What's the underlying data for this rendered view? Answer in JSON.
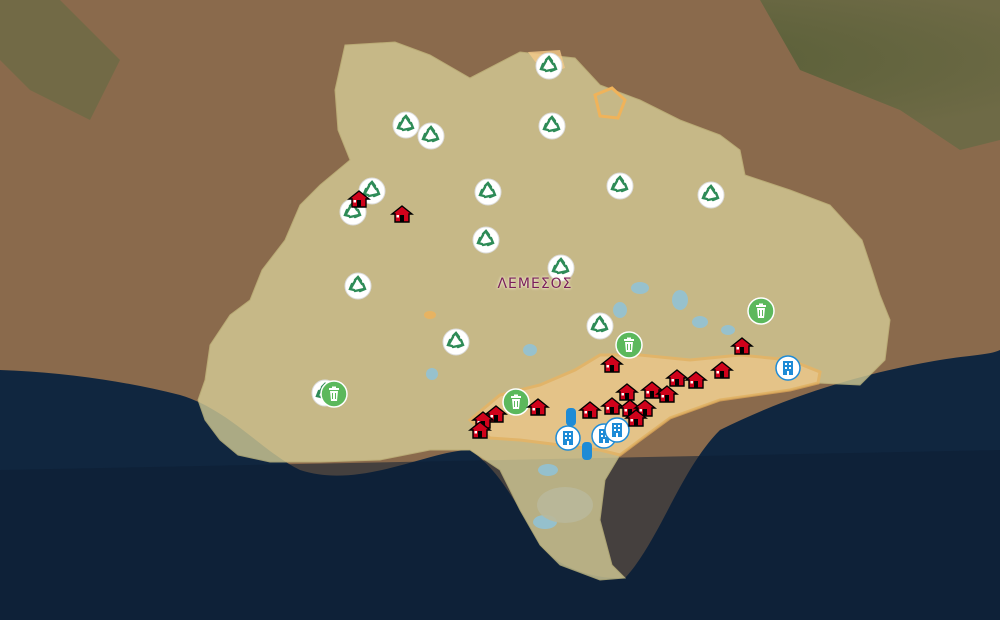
{
  "map": {
    "district_label": "ΛΕΜΕΣΟΣ",
    "colors": {
      "sea": "#10263f",
      "land": "#8a6a4c",
      "mountains": "#4d5a32",
      "district_fill": "#d7cf98",
      "urban_zone": "#f4c98a",
      "water_bodies": "#8cc4df",
      "recycling": "#2e8b57",
      "waste_bin": "#5cb85c",
      "heritage": "#d0021b",
      "building": "#1e8bd6"
    },
    "marker_types": {
      "recycling": "recycling-icon",
      "waste_bin": "waste-bin-icon",
      "heritage": "house-icon",
      "building": "building-icon"
    }
  }
}
